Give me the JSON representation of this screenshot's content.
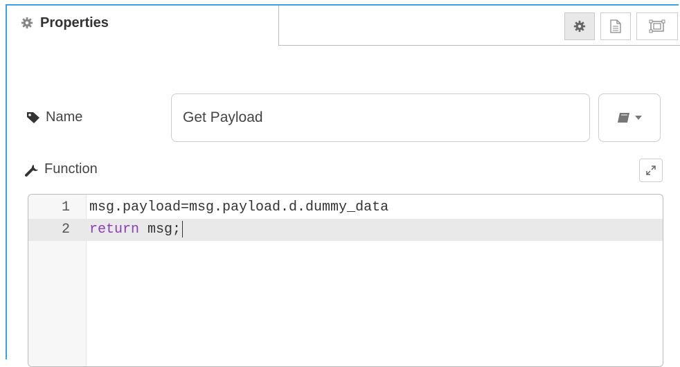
{
  "header": {
    "title": "Properties",
    "tabs": [
      {
        "icon": "gear-icon",
        "active": true
      },
      {
        "icon": "document-icon",
        "active": false
      },
      {
        "icon": "layout-icon",
        "active": false
      }
    ]
  },
  "name_field": {
    "label": "Name",
    "value": "Get Payload"
  },
  "function_field": {
    "label": "Function",
    "lines": [
      {
        "number": "1",
        "code": "msg.payload=msg.payload.d.dummy_data"
      },
      {
        "number": "2",
        "keyword": "return",
        "rest": " msg;"
      }
    ]
  },
  "colors": {
    "accent_border": "#3aa0e0",
    "keyword": "#8a3fb8",
    "active_line": "#e9e9e9"
  }
}
